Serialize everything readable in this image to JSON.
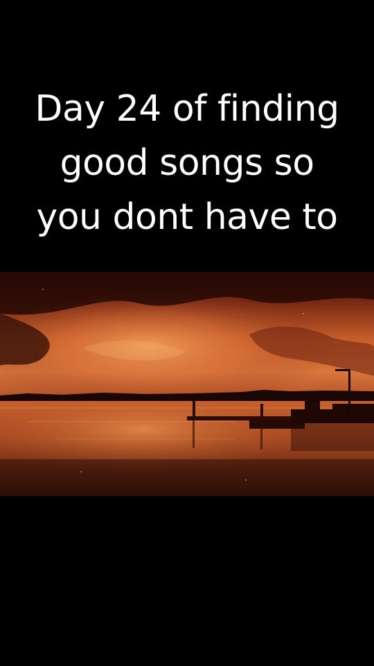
{
  "caption": {
    "line1": "Day 24 of finding",
    "line2": "good songs so",
    "line3": "you dont have to"
  },
  "colors": {
    "background": "#000000",
    "caption_text": "#ffffff",
    "sky_glow": "#e07a3c",
    "sky_dark": "#2a0a06",
    "water": "#c0552a"
  },
  "scene": {
    "subject": "sunset-over-lake-with-dock"
  }
}
